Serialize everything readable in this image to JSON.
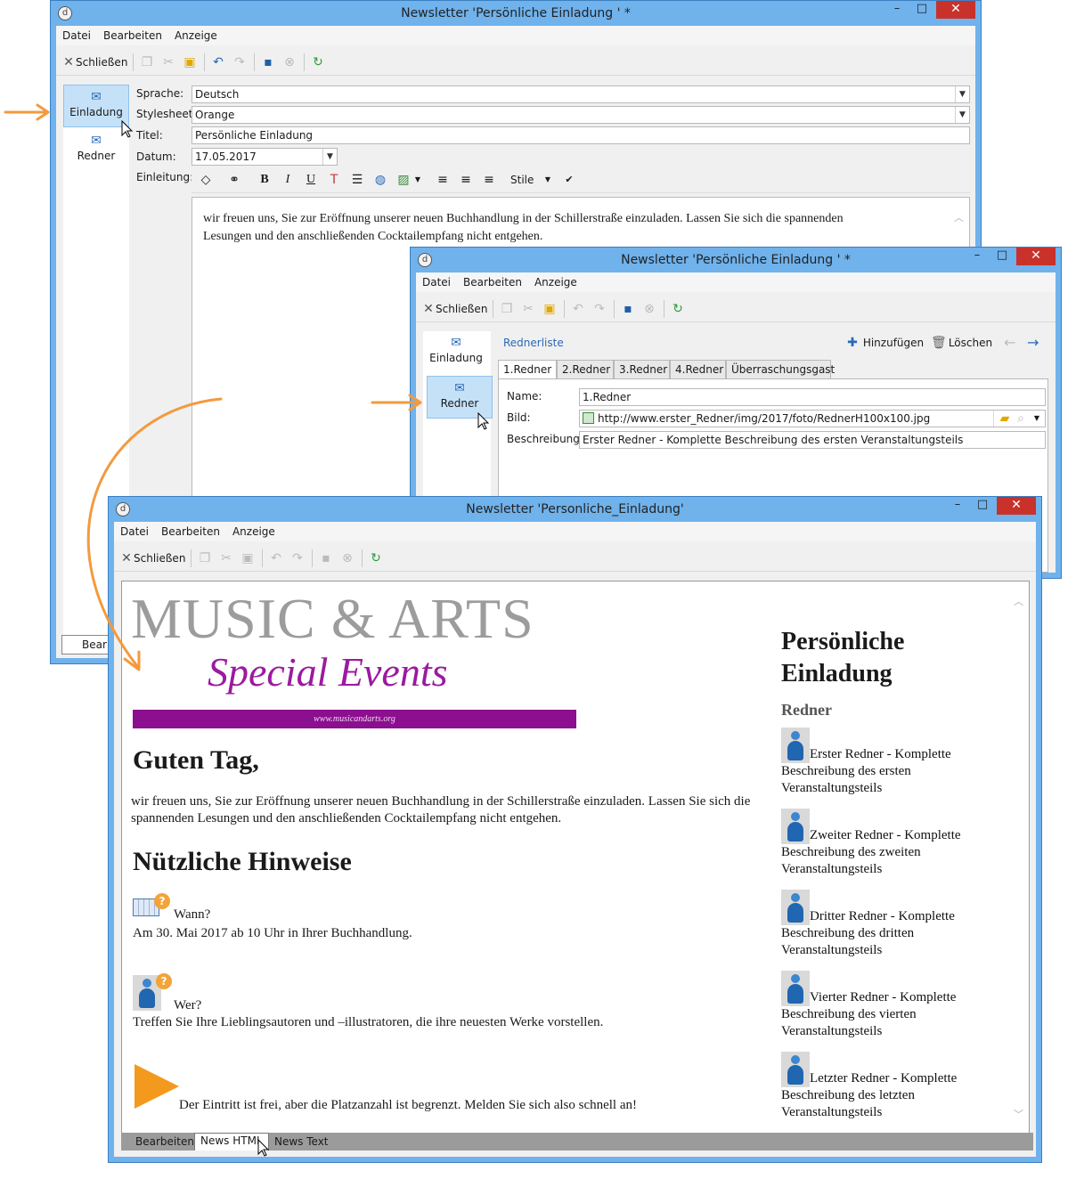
{
  "window1": {
    "title": "Newsletter 'Persönliche Einladung ' *",
    "menu": [
      "Datei",
      "Bearbeiten",
      "Anzeige"
    ],
    "toolbar": {
      "close_label": "Schließen"
    },
    "nav": [
      {
        "label": "Einladung",
        "active": true
      },
      {
        "label": "Redner",
        "active": false
      }
    ],
    "form": {
      "sprache_label": "Sprache:",
      "sprache_value": "Deutsch",
      "stylesheet_label": "Stylesheet:",
      "stylesheet_value": "Orange",
      "titel_label": "Titel:",
      "titel_value": "Persönliche Einladung",
      "datum_label": "Datum:",
      "datum_value": "17.05.2017",
      "einleitung_label": "Einleitung:"
    },
    "editor_toolbar": {
      "stile_label": "Stile"
    },
    "editor_text": "wir freuen uns, Sie zur Eröffnung unserer neuen Buchhandlung in der Schillerstraße einzuladen. Lassen Sie sich die spannenden Lesungen und den anschließenden Cocktailempfang nicht entgehen.",
    "bottom_tab": "Bearbe"
  },
  "window2": {
    "title": "Newsletter 'Persönliche Einladung ' *",
    "menu": [
      "Datei",
      "Bearbeiten",
      "Anzeige"
    ],
    "toolbar": {
      "close_label": "Schließen"
    },
    "nav": [
      {
        "label": "Einladung",
        "active": false
      },
      {
        "label": "Redner",
        "active": true
      }
    ],
    "list_title": "Rednerliste",
    "add_label": "Hinzufügen",
    "delete_label": "Löschen",
    "tabs": [
      "1.Redner",
      "2.Redner",
      "3.Redner",
      "4.Redner",
      "Überraschungsgast"
    ],
    "name_label": "Name:",
    "name_value": "1.Redner",
    "bild_label": "Bild:",
    "bild_value": "http://www.erster_Redner/img/2017/foto/RednerH100x100.jpg",
    "beschreibung_label": "Beschreibung:",
    "beschreibung_value": "Erster Redner - Komplette Beschreibung des ersten Veranstaltungsteils"
  },
  "window3": {
    "title": "Newsletter 'Personliche_Einladung'",
    "menu": [
      "Datei",
      "Bearbeiten",
      "Anzeige"
    ],
    "toolbar": {
      "close_label": "Schließen"
    },
    "banner": {
      "title": "MUSIC & ARTS",
      "subtitle": "Special Events",
      "url": "www.musicandarts.org"
    },
    "greeting": "Guten Tag,",
    "intro": "wir freuen uns, Sie zur Eröffnung unserer neuen Buchhandlung in der Schillerstraße einzuladen. Lassen Sie sich die spannenden Lesungen und den anschließenden Cocktailempfang nicht entgehen.",
    "hints_title": "Nützliche Hinweise",
    "when_label": "Wann?",
    "when_text": "Am 30. Mai 2017 ab 10 Uhr in Ihrer Buchhandlung.",
    "who_label": "Wer?",
    "who_text": "Treffen Sie Ihre Lieblingsautoren und –illustratoren, die ihre neuesten Werke vorstellen.",
    "entry_text": "Der Eintritt ist frei, aber die Platzanzahl ist begrenzt. Melden Sie sich also schnell an!",
    "side_title": "Persönliche Einladung",
    "side_subtitle": "Redner",
    "speakers": [
      "Erster Redner - Komplette Beschreibung des ersten Veranstaltungsteils",
      "Zweiter Redner - Komplette Beschreibung des zweiten Veranstaltungsteils",
      "Dritter Redner - Komplette Beschreibung des dritten Veranstaltungsteils",
      "Vierter Redner - Komplette Beschreibung des vierten Veranstaltungsteils",
      "Letzter Redner - Komplette Beschreibung des letzten Veranstaltungsteils"
    ],
    "bottom_tabs": [
      "Bearbeiten",
      "News HTML",
      "News Text"
    ],
    "active_bottom_tab": "News HTML"
  },
  "colors": {
    "accent_orange": "#f39a3e",
    "banner_purple": "#8b0f8f",
    "title_blue": "#6fb2ec",
    "close_red": "#c9312b"
  }
}
